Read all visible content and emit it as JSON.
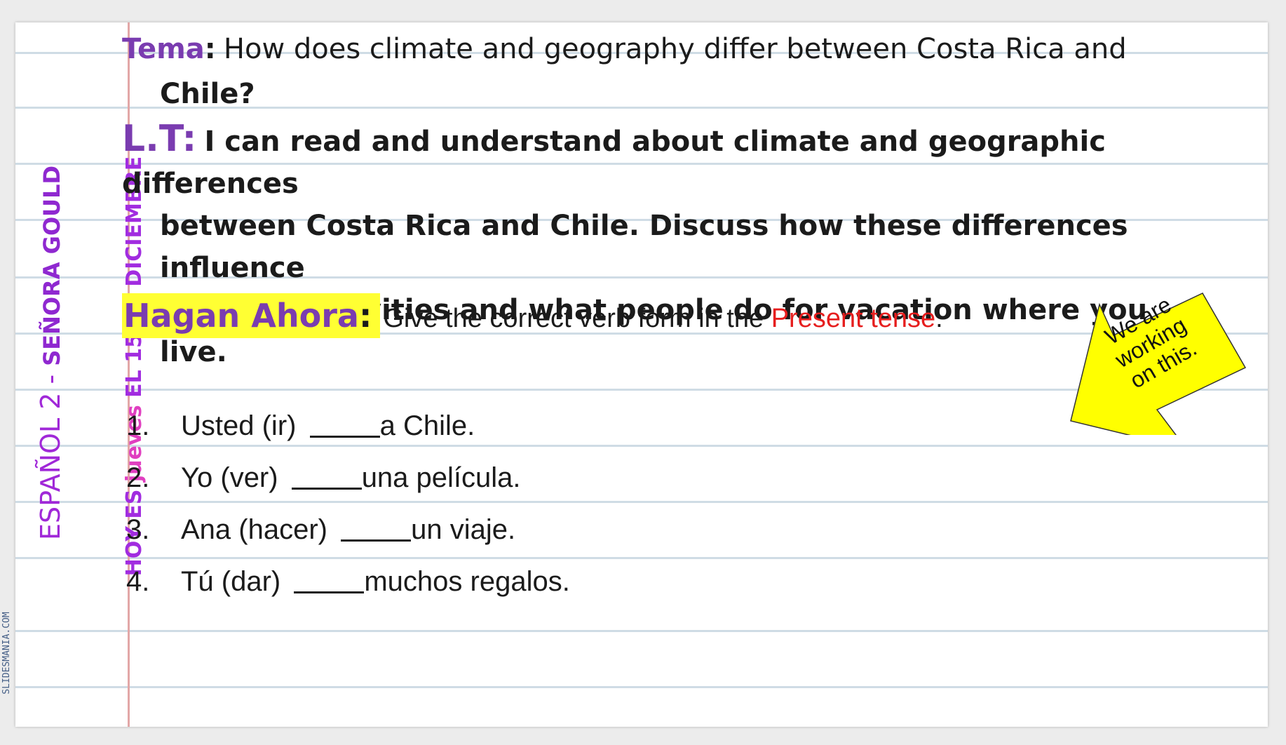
{
  "side": {
    "title_part1": "ESPAÑOL 2 - ",
    "title_part2": "SEÑORA GOULD",
    "date_part1": "HOY ES ",
    "date_part2": "jueves",
    "date_part3": " EL 15 DE DICIEMBRE",
    "watermark": "SLIDESMANIA.COM"
  },
  "tema": {
    "label": "Tema",
    "colon": ":",
    "text_line1": "How does climate and geography differ between Costa Rica and",
    "text_line2": "Chile?"
  },
  "lt": {
    "label": "L.T:",
    "line1": "I can read and understand about climate and geographic differences",
    "line2": "between Costa Rica and Chile. Discuss how these differences influence",
    "line3": "vacation activities and what people do for vacation where you live."
  },
  "hagan": {
    "label": "Hagan Ahora",
    "colon": ":",
    "instruction": "Give the correct verb form in the ",
    "highlight": "Present tense",
    "period": "."
  },
  "exercises": [
    {
      "num": "1.",
      "before": "Usted (ir) ",
      "after": "a Chile."
    },
    {
      "num": "2.",
      "before": "Yo (ver) ",
      "after": "una película."
    },
    {
      "num": "3.",
      "before": "Ana (hacer) ",
      "after": "un viaje."
    },
    {
      "num": "4.",
      "before": "Tú (dar) ",
      "after": "muchos regalos."
    }
  ],
  "callout": {
    "line1": "We are",
    "line2": "working",
    "line3": "on this.",
    "fill_color": "#ffff00"
  },
  "colors": {
    "purple": "#7a3cb0",
    "pink": "#e03fc0",
    "red": "#e61e1e",
    "highlight": "#ffff33"
  }
}
